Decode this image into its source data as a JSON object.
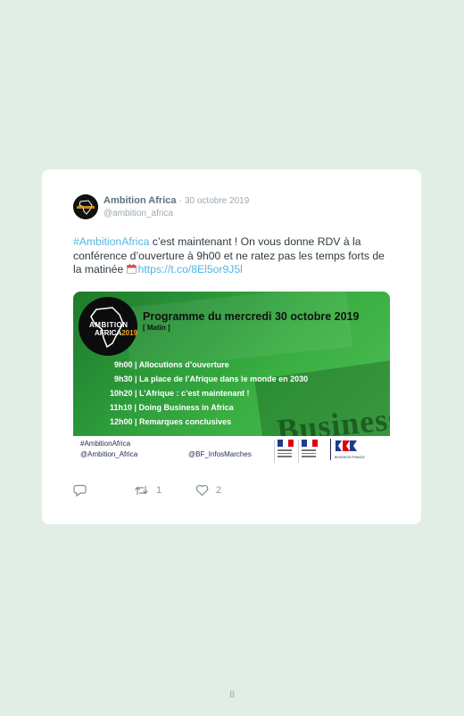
{
  "tweet": {
    "author_name": "Ambition Africa",
    "separator": "·",
    "date": "30 octobre 2019",
    "handle": "@ambition_africa",
    "hashtag": "#AmbitionAfrica",
    "text_part1": " c’est maintenant ! On vous donne RDV à la conférence d’ouverture à 9h00 et ne ratez pas les temps forts de la matinée ",
    "link": "https://t.co/8El5or9J5l",
    "retweet_count": "1",
    "like_count": "2"
  },
  "media": {
    "logo_line1": "AMBITION",
    "logo_line2a": "AFRICA",
    "logo_line2b": "2019",
    "title": "Programme du mercredi 30 octobre 2019",
    "subtitle": "[ Matin ]",
    "schedule": [
      "9h00 | Allocutions d’ouverture",
      "9h30 | La place de l’Afrique dans le monde en 2030",
      "10h20 | L’Afrique : c’est maintenant !",
      "11h10 | Doing Business in Africa",
      "12h00 | Remarques conclusives"
    ],
    "background_word": "Business",
    "footer_hashtag": "#AmbitionAfrica",
    "footer_account1": "@Ambition_Africa",
    "footer_account2": "@BF_InfosMarches",
    "bf_label": "BUSINESS FRANCE"
  },
  "icons": {
    "reply": "reply-icon",
    "retweet": "retweet-icon",
    "like": "heart-icon",
    "calendar": "calendar-icon"
  },
  "colors": {
    "background": "#e1eee6",
    "link": "#52b4e8",
    "banner_green": "#39ae41"
  },
  "page_number": "8"
}
